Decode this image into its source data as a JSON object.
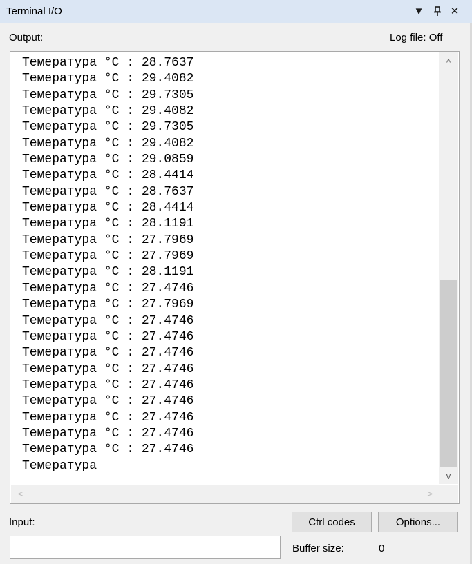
{
  "window": {
    "title": "Terminal I/O",
    "dropdown_glyph": "▼",
    "pin_glyph": "ᵖ",
    "close_glyph": "✕"
  },
  "output": {
    "label": "Output:",
    "log_file_status": "Log file: Off",
    "lines": [
      "Темератypa °C : 28.7637",
      "Темератypa °C : 29.4082",
      "Темератypa °C : 29.7305",
      "Темератypa °C : 29.4082",
      "Темератypa °C : 29.7305",
      "Темератypa °C : 29.4082",
      "Темератypa °C : 29.0859",
      "Темератypa °C : 28.4414",
      "Темератypa °C : 28.7637",
      "Темератypa °C : 28.4414",
      "Темератypa °C : 28.1191",
      "Темератypa °C : 27.7969",
      "Темератypa °C : 27.7969",
      "Темератypa °C : 28.1191",
      "Темератypa °C : 27.4746",
      "Темератypa °C : 27.7969",
      "Темератypa °C : 27.4746",
      "Темератypa °C : 27.4746",
      "Темератypa °C : 27.4746",
      "Темератypa °C : 27.4746",
      "Темератypa °C : 27.4746",
      "Темератypa °C : 27.4746",
      "Темератypa °C : 27.4746",
      "Темератypa °C : 27.4746",
      "Темератypa °C : 27.4746",
      "Темератypa"
    ]
  },
  "scrollbars": {
    "up_arrow": "^",
    "down_arrow": "v",
    "left_arrow": "<",
    "right_arrow": ">"
  },
  "controls": {
    "input_label": "Input:",
    "input_value": "",
    "ctrl_codes_label": "Ctrl codes",
    "options_label": "Options...",
    "buffer_size_label": "Buffer size:",
    "buffer_size_value": "0"
  }
}
